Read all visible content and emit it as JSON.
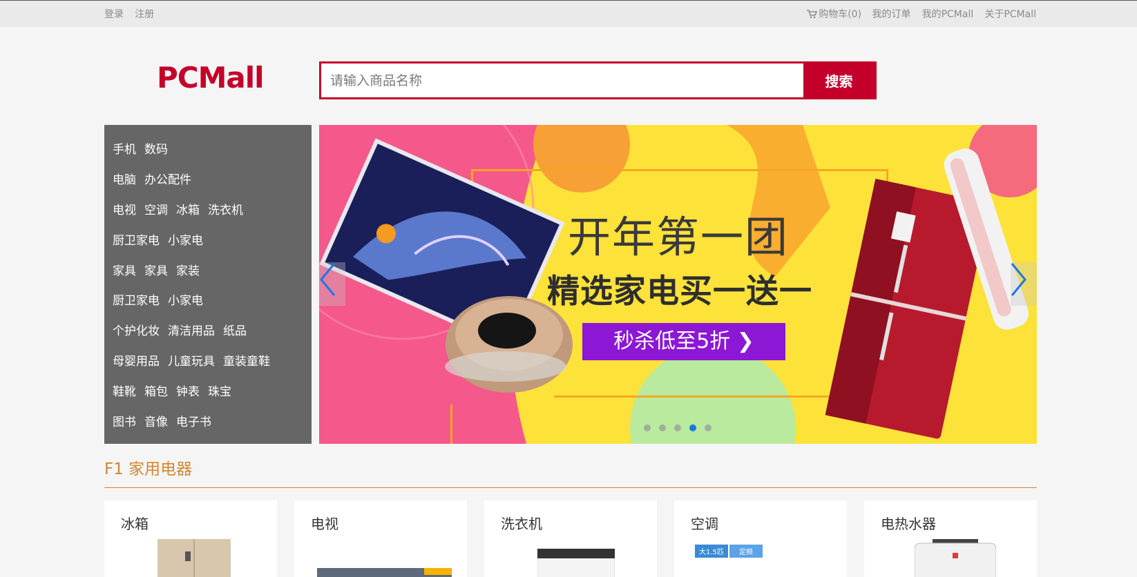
{
  "topbar": {
    "login": "登录",
    "register": "注册",
    "cart": "购物车(0)",
    "orders": "我的订单",
    "my_pcmall": "我的PCMall",
    "about": "关于PCMall"
  },
  "header": {
    "logo": "PCMall",
    "search_placeholder": "请输入商品名称",
    "search_button": "搜索"
  },
  "categories": [
    [
      "手机",
      "数码"
    ],
    [
      "电脑",
      "办公配件"
    ],
    [
      "电视",
      "空调",
      "冰箱",
      "洗衣机"
    ],
    [
      "厨卫家电",
      "小家电"
    ],
    [
      "家具",
      "家具",
      "家装"
    ],
    [
      "厨卫家电",
      "小家电"
    ],
    [
      "个护化妆",
      "清洁用品",
      "纸品"
    ],
    [
      "母婴用品",
      "儿童玩具",
      "童装童鞋"
    ],
    [
      "鞋靴",
      "箱包",
      "钟表",
      "珠宝"
    ],
    [
      "图书",
      "音像",
      "电子书"
    ]
  ],
  "banner": {
    "title": "开年第一团",
    "subtitle": "精选家电买一送一",
    "promo": "秒杀低至5折 ❯",
    "slide_count": 5,
    "active_slide": 4
  },
  "floor": {
    "title": "F1 家用电器",
    "products": [
      {
        "name": "冰箱"
      },
      {
        "name": "电视"
      },
      {
        "name": "洗衣机"
      },
      {
        "name": "空调"
      },
      {
        "name": "电热水器"
      }
    ]
  },
  "ac_badge": {
    "left": "大1.5匹",
    "right": "定频"
  },
  "colors": {
    "brand": "#c4002a",
    "floor": "#d2872e",
    "menu_bg": "#666666",
    "active_dot": "#1779e6"
  }
}
